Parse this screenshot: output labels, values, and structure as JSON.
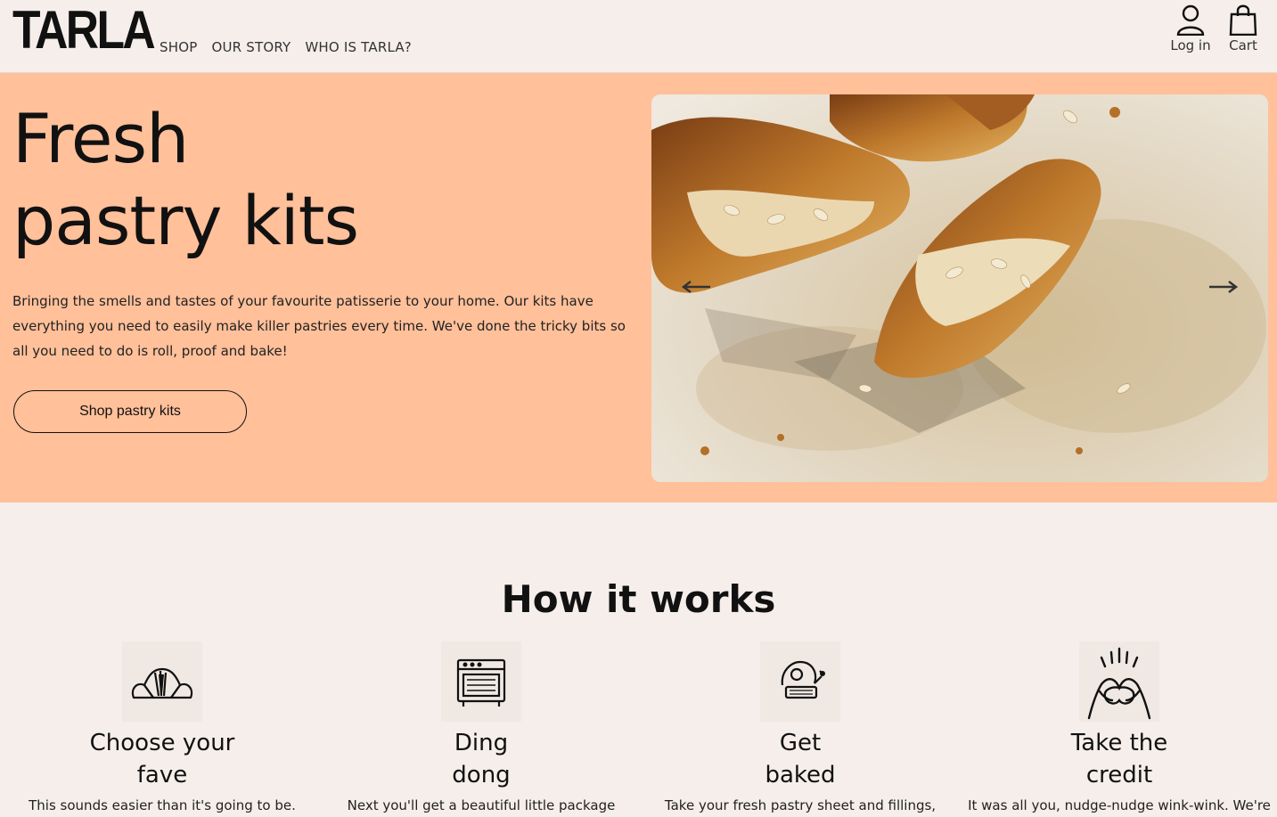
{
  "header": {
    "logo": "TARLA",
    "nav": [
      {
        "label": "SHOP"
      },
      {
        "label": "OUR STORY"
      },
      {
        "label": "WHO IS TARLA?"
      }
    ],
    "login_label": "Log in",
    "cart_label": "Cart"
  },
  "hero": {
    "title_line1": "Fresh",
    "title_line2": "pastry kits",
    "description": "Bringing the smells and tastes of your favourite patisserie to your home. Our kits have everything you need to easily make killer pastries every time. We've done the tricky bits so all you need to do is roll, proof and bake!",
    "button_label": "Shop pastry kits",
    "image_icon": "croissant-photo",
    "prev_icon": "arrow-left-icon",
    "next_icon": "arrow-right-icon"
  },
  "how": {
    "title": "How it works",
    "steps": [
      {
        "title_line1": "Choose your",
        "title_line2": "fave",
        "text": "This sounds easier than it's going to be.",
        "icon": "croissant-icon"
      },
      {
        "title_line1": "Ding",
        "title_line2": "dong",
        "text": "Next you'll get a beautiful little package",
        "icon": "oven-icon"
      },
      {
        "title_line1": "Get",
        "title_line2": "baked",
        "text": "Take your fresh pastry sheet and fillings,",
        "icon": "timer-bell-icon"
      },
      {
        "title_line1": "Take the",
        "title_line2": "credit",
        "text": "It was all you, nudge-nudge wink-wink. We're",
        "icon": "heart-hands-icon"
      }
    ]
  },
  "colors": {
    "background": "#f5eeea",
    "hero_background": "#ffc09a",
    "text": "#111111"
  }
}
